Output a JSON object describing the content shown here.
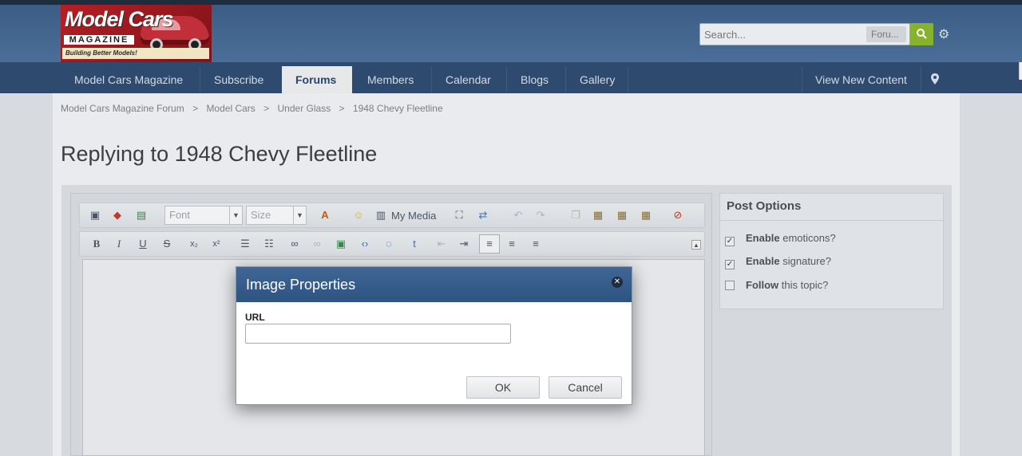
{
  "logo": {
    "title": "Model Cars",
    "subtitle": "MAGAZINE",
    "tagline": "Building Better Models!"
  },
  "search": {
    "placeholder": "Search...",
    "scope": "Foru..."
  },
  "nav": {
    "items": [
      {
        "label": "Model Cars Magazine"
      },
      {
        "label": "Subscribe"
      },
      {
        "label": "Forums"
      },
      {
        "label": "Members"
      },
      {
        "label": "Calendar"
      },
      {
        "label": "Blogs"
      },
      {
        "label": "Gallery"
      }
    ],
    "view_new": "View New Content"
  },
  "breadcrumbs": [
    "Model Cars Magazine Forum",
    ">",
    "Model Cars",
    ">",
    "Under Glass",
    ">",
    "1948 Chevy Fleetline"
  ],
  "page_title": "Replying to 1948 Chevy Fleetline",
  "editor": {
    "font_label": "Font",
    "size_label": "Size",
    "my_media": "My Media"
  },
  "post_options": {
    "title": "Post Options",
    "items": [
      {
        "bold": "Enable",
        "text": " emoticons?",
        "checked": true
      },
      {
        "bold": "Enable",
        "text": " signature?",
        "checked": true
      },
      {
        "bold": "Follow",
        "text": " this topic?",
        "checked": false
      }
    ]
  },
  "dialog": {
    "title": "Image Properties",
    "url_label": "URL",
    "url_value": "",
    "ok": "OK",
    "cancel": "Cancel"
  },
  "colors": {
    "header": "#3b5d85",
    "nav": "#2e4a6e",
    "search_button": "#87b22e",
    "dialog_header": "#2d5381"
  }
}
